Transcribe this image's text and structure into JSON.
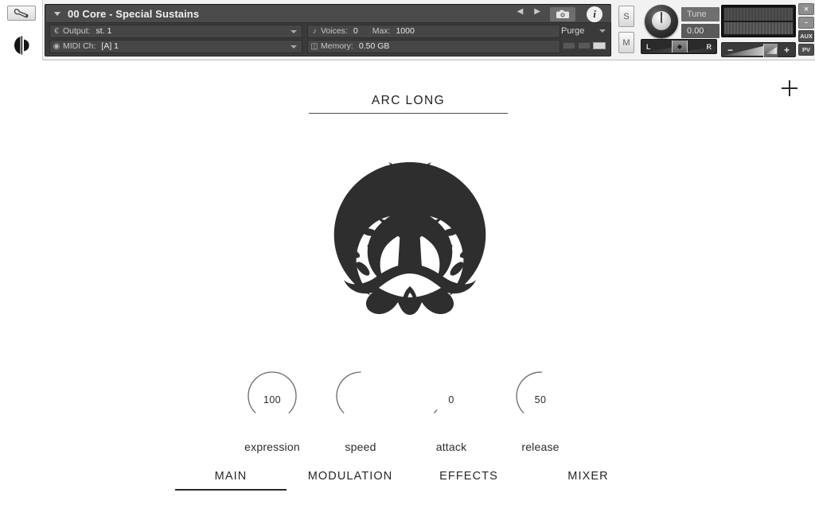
{
  "rack": {
    "wrench_icon": "wrench-icon",
    "ni_logo_icon": "native-instruments-logo",
    "rail_sliders_icon": "sliders-icon",
    "instrument_name": "00 Core - Special Sustains",
    "prev_icon": "previous-arrow-icon",
    "next_icon": "next-arrow-icon",
    "camera_icon": "camera-icon",
    "info_icon": "info-icon",
    "output": {
      "icon": "output-icon",
      "label": "Output:",
      "value": "st. 1"
    },
    "midi": {
      "icon": "midi-icon",
      "label": "MIDI Ch:",
      "value": "[A] 1"
    },
    "voices": {
      "icon": "voices-icon",
      "label": "Voices:",
      "value": "0",
      "max_label": "Max:",
      "max_value": "1000"
    },
    "memory": {
      "icon": "memory-icon",
      "label": "Memory:",
      "value": "0.50 GB"
    },
    "purge": {
      "label": "Purge",
      "caret_icon": "chevron-down-icon"
    },
    "solo_label": "S",
    "mute_label": "M",
    "tune": {
      "label": "Tune",
      "value": "0.00"
    },
    "pan": {
      "left_label": "L",
      "right_label": "R",
      "handle_icon": "pan-handle-icon"
    },
    "volume": {
      "minus_label": "−",
      "plus_label": "+"
    },
    "edge_buttons": [
      {
        "name": "close-button",
        "label": "✕"
      },
      {
        "name": "minimize-button",
        "label": "−"
      },
      {
        "name": "aux-button",
        "label": "AUX"
      },
      {
        "name": "pv-button",
        "label": "PV"
      }
    ]
  },
  "panel": {
    "add_icon": "plus-icon",
    "instrument_title": "ARC LONG",
    "logo_icon": "tree-of-life-logo",
    "knobs": [
      {
        "label": "expression",
        "value": "100",
        "percent": 100
      },
      {
        "label": "speed",
        "value": "",
        "percent": 50
      },
      {
        "label": "attack",
        "value": "0",
        "percent": 0
      },
      {
        "label": "release",
        "value": "50",
        "percent": 50
      }
    ],
    "tabs": [
      {
        "label": "MAIN",
        "active": true
      },
      {
        "label": "MODULATION",
        "active": false
      },
      {
        "label": "EFFECTS",
        "active": false
      },
      {
        "label": "MIXER",
        "active": false
      }
    ]
  },
  "colors": {
    "rack_bg": "#f2f2f2",
    "strip_bg": "#3a3a3a",
    "panel_bg": "#ffffff",
    "text_dark": "#262626",
    "knob_arc": "#555555"
  }
}
